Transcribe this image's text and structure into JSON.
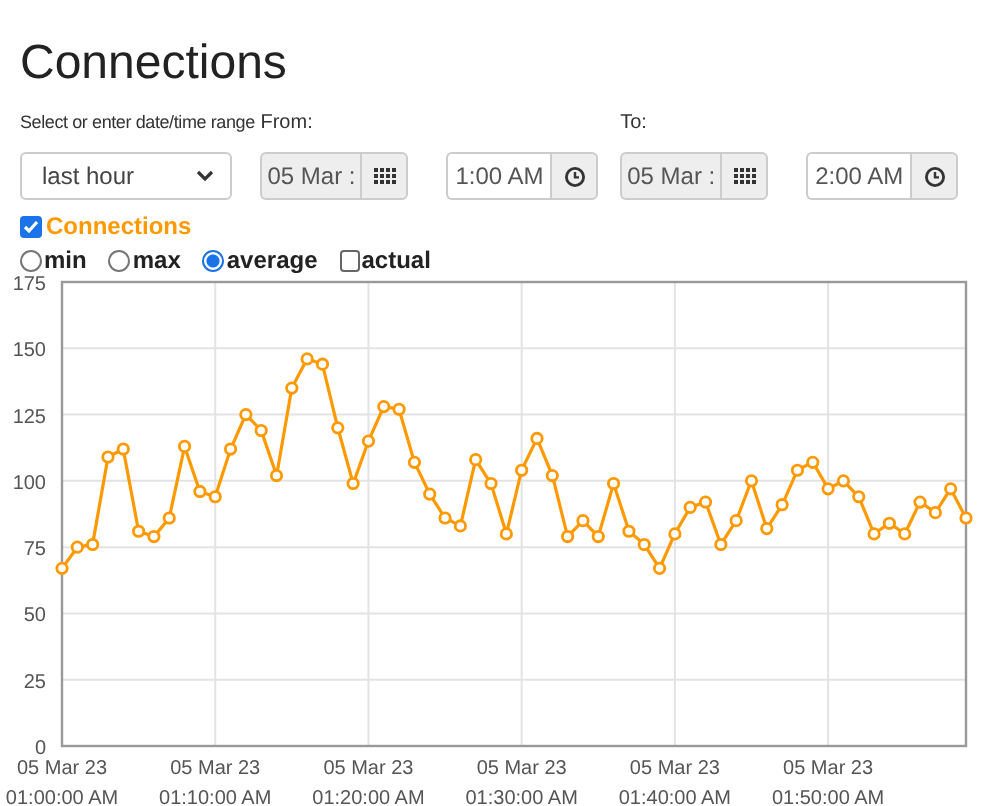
{
  "title": "Connections",
  "range": {
    "label": "Select or enter date/time range",
    "value": "last hour"
  },
  "from": {
    "label": "From:",
    "date": "05 Mar :",
    "time": "1:00 AM"
  },
  "to": {
    "label": "To:",
    "date": "05 Mar :",
    "time": "2:00 AM"
  },
  "series_toggle": {
    "checked": true
  },
  "modes": [
    {
      "kind": "radio",
      "label": "min",
      "selected": false
    },
    {
      "kind": "radio",
      "label": "max",
      "selected": false
    },
    {
      "kind": "radio",
      "label": "average",
      "selected": true
    },
    {
      "kind": "checkbox",
      "label": "actual",
      "selected": false
    }
  ],
  "chart_data": {
    "type": "line",
    "categories": [
      "05 Mar 23 01:00:00 AM",
      null,
      null,
      null,
      null,
      null,
      null,
      null,
      null,
      null,
      "05 Mar 23 01:10:00 AM",
      null,
      null,
      null,
      null,
      null,
      null,
      null,
      null,
      null,
      "05 Mar 23 01:20:00 AM",
      null,
      null,
      null,
      null,
      null,
      null,
      null,
      null,
      null,
      "05 Mar 23 01:30:00 AM",
      null,
      null,
      null,
      null,
      null,
      null,
      null,
      null,
      null,
      "05 Mar 23 01:40:00 AM",
      null,
      null,
      null,
      null,
      null,
      null,
      null,
      null,
      null,
      "05 Mar 23 01:50:00 AM",
      null,
      null,
      null,
      null,
      null,
      null,
      null,
      null,
      null
    ],
    "grid": true,
    "series": [
      {
        "name": "Connections",
        "color": "#ff9900",
        "marker": true,
        "values": [
          67,
          75,
          76,
          109,
          112,
          81,
          79,
          86,
          113,
          96,
          94,
          112,
          125,
          119,
          102,
          135,
          146,
          144,
          120,
          99,
          115,
          128,
          127,
          107,
          95,
          86,
          83,
          108,
          99,
          80,
          104,
          116,
          102,
          79,
          85,
          79,
          99,
          81,
          76,
          67,
          80,
          90,
          92,
          76,
          85,
          100,
          82,
          91,
          104,
          107,
          97,
          100,
          94,
          80,
          84,
          80,
          92,
          88,
          97,
          86
        ]
      }
    ],
    "ylim": [
      0,
      175
    ],
    "yticks": [
      0,
      25,
      50,
      75,
      100,
      125,
      150,
      175
    ]
  }
}
